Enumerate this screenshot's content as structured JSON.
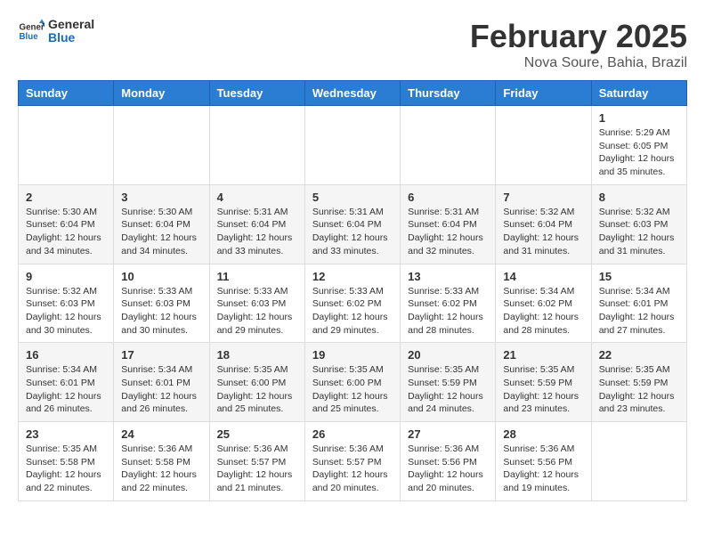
{
  "logo": {
    "line1": "General",
    "line2": "Blue"
  },
  "header": {
    "month": "February 2025",
    "location": "Nova Soure, Bahia, Brazil"
  },
  "weekdays": [
    "Sunday",
    "Monday",
    "Tuesday",
    "Wednesday",
    "Thursday",
    "Friday",
    "Saturday"
  ],
  "weeks": [
    [
      {
        "day": "",
        "info": ""
      },
      {
        "day": "",
        "info": ""
      },
      {
        "day": "",
        "info": ""
      },
      {
        "day": "",
        "info": ""
      },
      {
        "day": "",
        "info": ""
      },
      {
        "day": "",
        "info": ""
      },
      {
        "day": "1",
        "info": "Sunrise: 5:29 AM\nSunset: 6:05 PM\nDaylight: 12 hours\nand 35 minutes."
      }
    ],
    [
      {
        "day": "2",
        "info": "Sunrise: 5:30 AM\nSunset: 6:04 PM\nDaylight: 12 hours\nand 34 minutes."
      },
      {
        "day": "3",
        "info": "Sunrise: 5:30 AM\nSunset: 6:04 PM\nDaylight: 12 hours\nand 34 minutes."
      },
      {
        "day": "4",
        "info": "Sunrise: 5:31 AM\nSunset: 6:04 PM\nDaylight: 12 hours\nand 33 minutes."
      },
      {
        "day": "5",
        "info": "Sunrise: 5:31 AM\nSunset: 6:04 PM\nDaylight: 12 hours\nand 33 minutes."
      },
      {
        "day": "6",
        "info": "Sunrise: 5:31 AM\nSunset: 6:04 PM\nDaylight: 12 hours\nand 32 minutes."
      },
      {
        "day": "7",
        "info": "Sunrise: 5:32 AM\nSunset: 6:04 PM\nDaylight: 12 hours\nand 31 minutes."
      },
      {
        "day": "8",
        "info": "Sunrise: 5:32 AM\nSunset: 6:03 PM\nDaylight: 12 hours\nand 31 minutes."
      }
    ],
    [
      {
        "day": "9",
        "info": "Sunrise: 5:32 AM\nSunset: 6:03 PM\nDaylight: 12 hours\nand 30 minutes."
      },
      {
        "day": "10",
        "info": "Sunrise: 5:33 AM\nSunset: 6:03 PM\nDaylight: 12 hours\nand 30 minutes."
      },
      {
        "day": "11",
        "info": "Sunrise: 5:33 AM\nSunset: 6:03 PM\nDaylight: 12 hours\nand 29 minutes."
      },
      {
        "day": "12",
        "info": "Sunrise: 5:33 AM\nSunset: 6:02 PM\nDaylight: 12 hours\nand 29 minutes."
      },
      {
        "day": "13",
        "info": "Sunrise: 5:33 AM\nSunset: 6:02 PM\nDaylight: 12 hours\nand 28 minutes."
      },
      {
        "day": "14",
        "info": "Sunrise: 5:34 AM\nSunset: 6:02 PM\nDaylight: 12 hours\nand 28 minutes."
      },
      {
        "day": "15",
        "info": "Sunrise: 5:34 AM\nSunset: 6:01 PM\nDaylight: 12 hours\nand 27 minutes."
      }
    ],
    [
      {
        "day": "16",
        "info": "Sunrise: 5:34 AM\nSunset: 6:01 PM\nDaylight: 12 hours\nand 26 minutes."
      },
      {
        "day": "17",
        "info": "Sunrise: 5:34 AM\nSunset: 6:01 PM\nDaylight: 12 hours\nand 26 minutes."
      },
      {
        "day": "18",
        "info": "Sunrise: 5:35 AM\nSunset: 6:00 PM\nDaylight: 12 hours\nand 25 minutes."
      },
      {
        "day": "19",
        "info": "Sunrise: 5:35 AM\nSunset: 6:00 PM\nDaylight: 12 hours\nand 25 minutes."
      },
      {
        "day": "20",
        "info": "Sunrise: 5:35 AM\nSunset: 5:59 PM\nDaylight: 12 hours\nand 24 minutes."
      },
      {
        "day": "21",
        "info": "Sunrise: 5:35 AM\nSunset: 5:59 PM\nDaylight: 12 hours\nand 23 minutes."
      },
      {
        "day": "22",
        "info": "Sunrise: 5:35 AM\nSunset: 5:59 PM\nDaylight: 12 hours\nand 23 minutes."
      }
    ],
    [
      {
        "day": "23",
        "info": "Sunrise: 5:35 AM\nSunset: 5:58 PM\nDaylight: 12 hours\nand 22 minutes."
      },
      {
        "day": "24",
        "info": "Sunrise: 5:36 AM\nSunset: 5:58 PM\nDaylight: 12 hours\nand 22 minutes."
      },
      {
        "day": "25",
        "info": "Sunrise: 5:36 AM\nSunset: 5:57 PM\nDaylight: 12 hours\nand 21 minutes."
      },
      {
        "day": "26",
        "info": "Sunrise: 5:36 AM\nSunset: 5:57 PM\nDaylight: 12 hours\nand 20 minutes."
      },
      {
        "day": "27",
        "info": "Sunrise: 5:36 AM\nSunset: 5:56 PM\nDaylight: 12 hours\nand 20 minutes."
      },
      {
        "day": "28",
        "info": "Sunrise: 5:36 AM\nSunset: 5:56 PM\nDaylight: 12 hours\nand 19 minutes."
      },
      {
        "day": "",
        "info": ""
      }
    ]
  ]
}
